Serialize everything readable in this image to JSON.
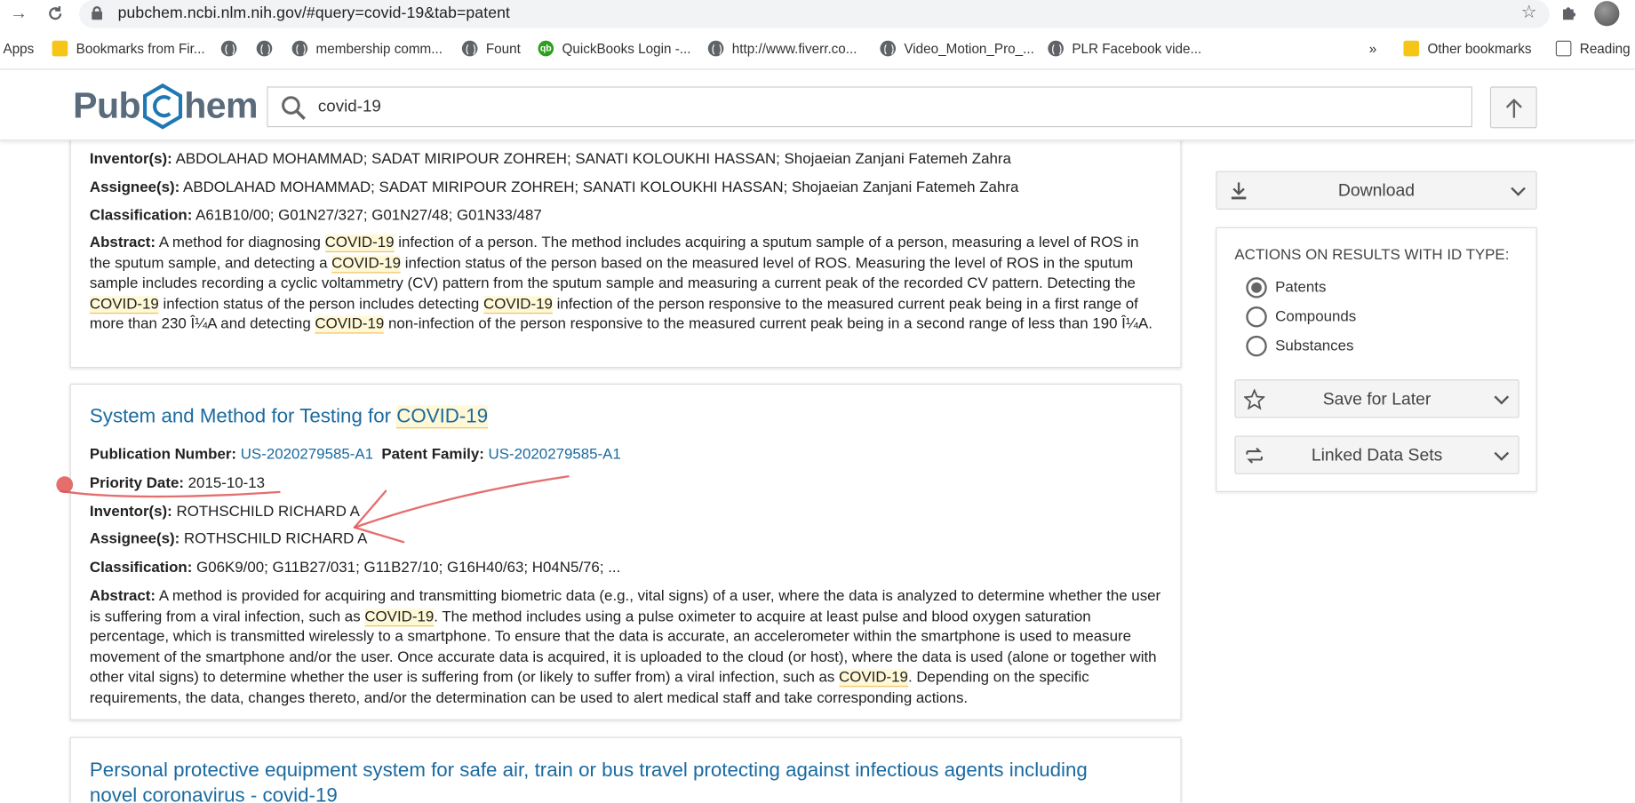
{
  "browser": {
    "url": "pubchem.ncbi.nlm.nih.gov/#query=covid-19&tab=patent",
    "bookmarks": [
      {
        "label": "Apps",
        "icon": "apps-icon"
      },
      {
        "label": "Bookmarks from Fir...",
        "icon": "folder-icon"
      },
      {
        "label": "",
        "icon": "globe-icon"
      },
      {
        "label": "",
        "icon": "globe-icon"
      },
      {
        "label": "membership comm...",
        "icon": "globe-icon"
      },
      {
        "label": "Fount",
        "icon": "globe-icon"
      },
      {
        "label": "QuickBooks Login -...",
        "icon": "quickbooks-icon"
      },
      {
        "label": "http://www.fiverr.co...",
        "icon": "globe-icon"
      },
      {
        "label": "Video_Motion_Pro_...",
        "icon": "globe-icon"
      },
      {
        "label": "PLR Facebook vide...",
        "icon": "globe-icon"
      },
      {
        "label": "»",
        "icon": "more-icon"
      },
      {
        "label": "Other bookmarks",
        "icon": "folder-icon"
      },
      {
        "label": "Reading",
        "icon": "reading-list-icon"
      }
    ]
  },
  "header": {
    "logo_left": "Pub",
    "logo_right": "hem",
    "search_value": "covid-19"
  },
  "results": [
    {
      "inventors": "ABDOLAHAD MOHAMMAD; SADAT MIRIPOUR ZOHREH; SANATI KOLOUKHI HASSAN; Shojaeian Zanjani Fatemeh Zahra",
      "assignees": "ABDOLAHAD MOHAMMAD; SADAT MIRIPOUR ZOHREH; SANATI KOLOUKHI HASSAN; Shojaeian Zanjani Fatemeh Zahra",
      "classification": "A61B10/00; G01N27/327; G01N27/48; G01N33/487",
      "abstract_parts": [
        "A method for diagnosing ",
        "COVID-19",
        " infection of a person. The method includes acquiring a sputum sample of a person, measuring a level of ROS in the sputum sample, and detecting a ",
        "COVID-19",
        " infection status of the person based on the measured level of ROS. Measuring the level of ROS in the sputum sample includes recording a cyclic voltammetry (CV) pattern from the sputum sample and measuring a current peak of the recorded CV pattern. Detecting the ",
        "COVID-19",
        " infection status of the person includes detecting ",
        "COVID-19",
        " infection of the person responsive to the measured current peak being in a first range of more than 230 Î¼A and detecting ",
        "COVID-19",
        " non-infection of the person responsive to the measured current peak being in a second range of less than 190 Î¼A."
      ]
    },
    {
      "title_prefix": "System and Method for Testing for ",
      "title_hl": "COVID-19",
      "publication_number": "US-2020279585-A1",
      "patent_family": "US-2020279585-A1",
      "priority_date": "2015-10-13",
      "inventors": "ROTHSCHILD RICHARD A",
      "assignees": "ROTHSCHILD RICHARD A",
      "classification": "G06K9/00; G11B27/031; G11B27/10; G16H40/63; H04N5/76; ...",
      "abstract_parts": [
        "A method is provided for acquiring and transmitting biometric data (e.g., vital signs) of a user, where the data is analyzed to determine whether the user is suffering from a viral infection, such as ",
        "COVID-19",
        ". The method includes using a pulse oximeter to acquire at least pulse and blood oxygen saturation percentage, which is transmitted wirelessly to a smartphone. To ensure that the data is accurate, an accelerometer within the smartphone is used to measure movement of the smartphone and/or the user. Once accurate data is acquired, it is uploaded to the cloud (or host), where the data is used (alone or together with other vital signs) to determine whether the user is suffering from (or likely to suffer from) a viral infection, such as ",
        "COVID-19",
        ". Depending on the specific requirements, the data, changes thereto, and/or the determination can be used to alert medical staff and take corresponding actions."
      ]
    },
    {
      "title_line1": "Personal protective equipment system for safe air, train or bus travel protecting against infectious agents including",
      "title_line2": "novel coronavirus - covid-19"
    }
  ],
  "labels": {
    "inventors": "Inventor(s):",
    "assignees": "Assignee(s):",
    "classification": "Classification:",
    "abstract": "Abstract:",
    "publication_number": "Publication Number:",
    "patent_family": "Patent Family:",
    "priority_date": "Priority Date:"
  },
  "sidebar": {
    "download_label": "Download",
    "actions_title": "ACTIONS ON RESULTS WITH ID TYPE:",
    "id_types": [
      {
        "label": "Patents",
        "selected": true
      },
      {
        "label": "Compounds",
        "selected": false
      },
      {
        "label": "Substances",
        "selected": false
      }
    ],
    "save_label": "Save for Later",
    "linked_label": "Linked Data Sets"
  },
  "colors": {
    "link": "#1a6aa0",
    "highlight_bg": "#fff8d6",
    "annotation": "#e05555"
  }
}
